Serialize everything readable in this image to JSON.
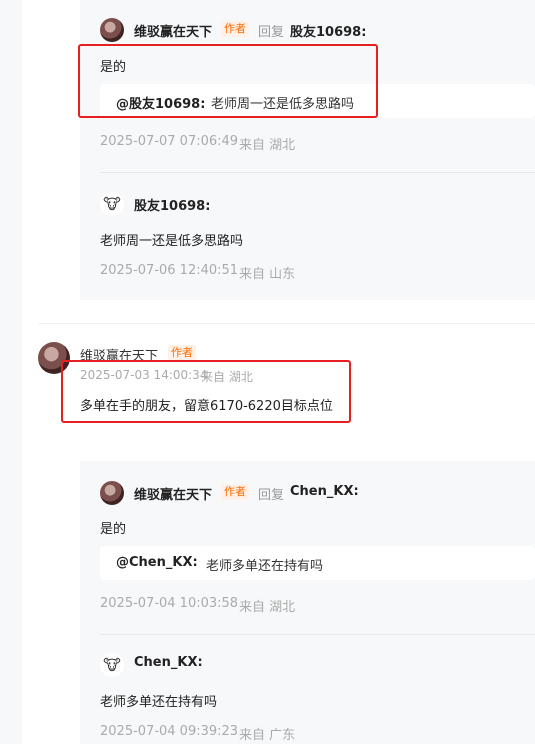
{
  "author_tag": "作者",
  "reply_word": "回复",
  "thread1": {
    "reply": {
      "user": "维驳赢在天下",
      "target": "股友10698:",
      "text": "是的",
      "quote_user": "@股友10698:",
      "quote_text": "老师周一还是低多思路吗",
      "time": "2025-07-07 07:06:49",
      "location": "来自 湖北"
    },
    "orig": {
      "user": "股友10698:",
      "avatar_icon": "🐮",
      "text": "老师周一还是低多思路吗",
      "time": "2025-07-06 12:40:51",
      "location": "来自 山东"
    }
  },
  "comment": {
    "user": "维驳赢在天下",
    "time": "2025-07-03 14:00:34",
    "location": "来自 湖北",
    "text": "多单在手的朋友，留意6170-6220目标点位"
  },
  "thread2": {
    "reply": {
      "user": "维驳赢在天下",
      "target": "Chen_KX:",
      "text": "是的",
      "quote_user": "@Chen_KX:",
      "quote_text": "老师多单还在持有吗",
      "time": "2025-07-04 10:03:58",
      "location": "来自 湖北"
    },
    "orig": {
      "user": "Chen_KX:",
      "avatar_icon": "🐮",
      "text": "老师多单还在持有吗",
      "time": "2025-07-04 09:39:23",
      "location": "来自 广东"
    }
  },
  "colors": {
    "highlight": "#e62020",
    "author_tag": "#ff6a00",
    "panel_bg": "#f7f8fa"
  }
}
